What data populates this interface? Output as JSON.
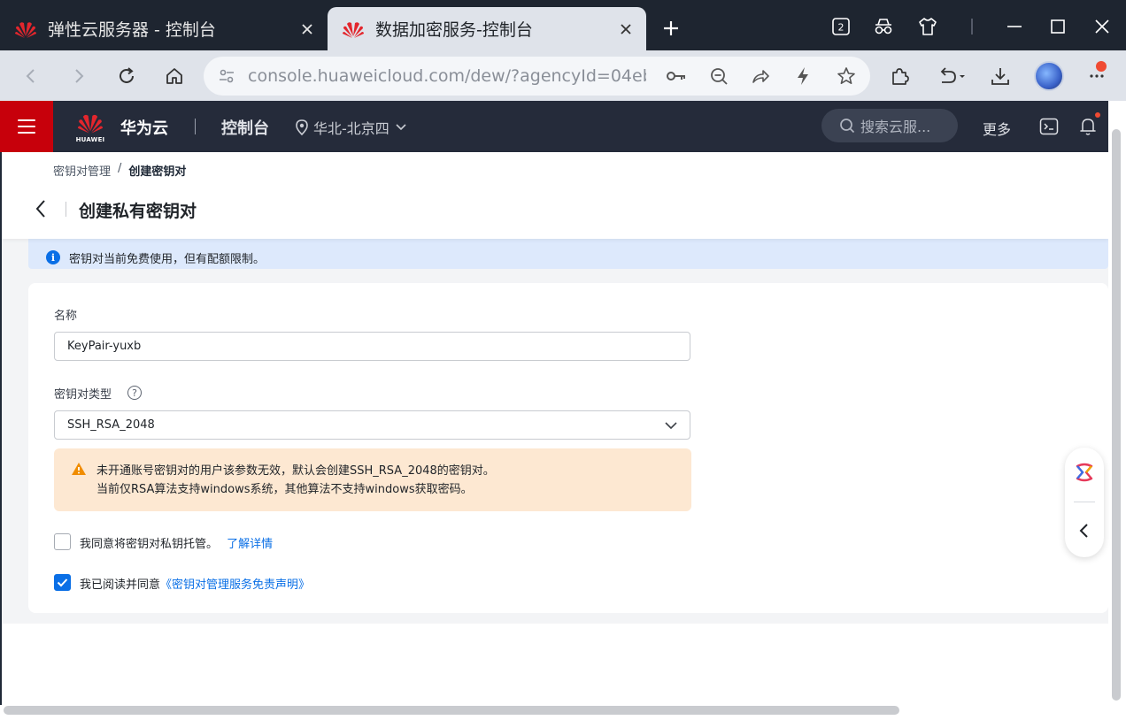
{
  "browser": {
    "tabs": [
      {
        "title": "弹性云服务器 - 控制台",
        "active": false
      },
      {
        "title": "数据加密服务-控制台",
        "active": true
      }
    ],
    "tab_count_badge": "2",
    "url": "console.huaweicloud.com/dew/?agencyId=04ebe5..."
  },
  "header": {
    "logo_text": "HUAWEI",
    "brand": "华为云",
    "console_title": "控制台",
    "region": "华北-北京四",
    "search_placeholder": "搜索云服...",
    "more_label": "更多"
  },
  "page": {
    "breadcrumb": {
      "parent": "密钥对管理",
      "separator": "/",
      "current": "创建密钥对"
    },
    "title": "创建私有密钥对",
    "info_banner": "密钥对当前免费使用，但有配额限制。",
    "form": {
      "name_label": "名称",
      "name_value": "KeyPair-yuxb",
      "type_label": "密钥对类型",
      "type_help": "?",
      "type_value": "SSH_RSA_2048",
      "warning_line1": "未开通账号密钥对的用户该参数无效，默认会创建SSH_RSA_2048的密钥对。",
      "warning_line2": "当前仅RSA算法支持windows系统，其他算法不支持windows获取密码。",
      "escrow_checkbox": {
        "label": "我同意将密钥对私钥托管。",
        "link": "了解详情",
        "checked": false
      },
      "agree_checkbox": {
        "label": "我已阅读并同意",
        "link": "《密钥对管理服务免责声明》",
        "checked": true
      }
    }
  },
  "colors": {
    "brand_red": "#c7000b",
    "header_bg": "#252b3a",
    "accent_blue": "#0a6fe6",
    "info_bg": "#dde9fc",
    "warning_bg": "#fde8d2",
    "warning_icon": "#f08c00"
  }
}
